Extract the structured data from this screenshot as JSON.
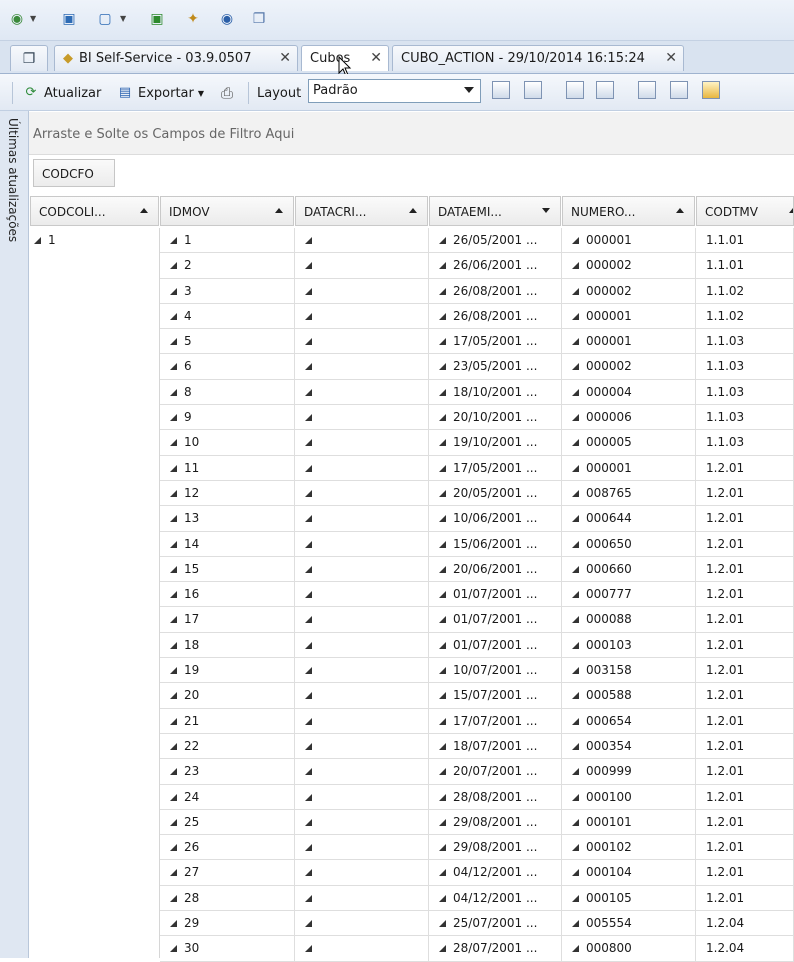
{
  "quick_access": {
    "icons": [
      "globe-add-icon",
      "window-restore-icon",
      "window-icon",
      "export-icon",
      "magic-wand-icon",
      "web-globe-icon",
      "copy-icon"
    ]
  },
  "tabs": [
    {
      "label": "BI Self-Service - 03.9.0507",
      "closable": true
    },
    {
      "label": "Cubos",
      "closable": true
    },
    {
      "label": "CUBO_ACTION - 29/10/2014 16:15:24",
      "closable": true
    }
  ],
  "toolbar": {
    "refresh_label": "Atualizar",
    "export_label": "Exportar",
    "layout_label": "Layout",
    "layout_value": "Padrão"
  },
  "side_panel": {
    "label": "Últimas atualizações"
  },
  "filter_area": {
    "placeholder": "Arraste e Solte os Campos de Filtro Aqui"
  },
  "row_field": {
    "label": "CODCFO"
  },
  "columns": [
    {
      "label": "CODCOLI...",
      "sort": "asc"
    },
    {
      "label": "IDMOV",
      "sort": "asc"
    },
    {
      "label": "DATACRI...",
      "sort": "asc"
    },
    {
      "label": "DATAEMI...",
      "sort": "desc"
    },
    {
      "label": "NUMERO...",
      "sort": "asc"
    },
    {
      "label": "CODTMV",
      "sort": "asc"
    }
  ],
  "group_value": "1",
  "rows": [
    {
      "idmov": "1",
      "dataemi": "26/05/2001 ...",
      "numero": "000001",
      "codtmv": "1.1.01"
    },
    {
      "idmov": "2",
      "dataemi": "26/06/2001 ...",
      "numero": "000002",
      "codtmv": "1.1.01"
    },
    {
      "idmov": "3",
      "dataemi": "26/08/2001 ...",
      "numero": "000002",
      "codtmv": "1.1.02"
    },
    {
      "idmov": "4",
      "dataemi": "26/08/2001 ...",
      "numero": "000001",
      "codtmv": "1.1.02"
    },
    {
      "idmov": "5",
      "dataemi": "17/05/2001 ...",
      "numero": "000001",
      "codtmv": "1.1.03"
    },
    {
      "idmov": "6",
      "dataemi": "23/05/2001 ...",
      "numero": "000002",
      "codtmv": "1.1.03"
    },
    {
      "idmov": "8",
      "dataemi": "18/10/2001 ...",
      "numero": "000004",
      "codtmv": "1.1.03"
    },
    {
      "idmov": "9",
      "dataemi": "20/10/2001 ...",
      "numero": "000006",
      "codtmv": "1.1.03"
    },
    {
      "idmov": "10",
      "dataemi": "19/10/2001 ...",
      "numero": "000005",
      "codtmv": "1.1.03"
    },
    {
      "idmov": "11",
      "dataemi": "17/05/2001 ...",
      "numero": "000001",
      "codtmv": "1.2.01"
    },
    {
      "idmov": "12",
      "dataemi": "20/05/2001 ...",
      "numero": "008765",
      "codtmv": "1.2.01"
    },
    {
      "idmov": "13",
      "dataemi": "10/06/2001 ...",
      "numero": "000644",
      "codtmv": "1.2.01"
    },
    {
      "idmov": "14",
      "dataemi": "15/06/2001 ...",
      "numero": "000650",
      "codtmv": "1.2.01"
    },
    {
      "idmov": "15",
      "dataemi": "20/06/2001 ...",
      "numero": "000660",
      "codtmv": "1.2.01"
    },
    {
      "idmov": "16",
      "dataemi": "01/07/2001 ...",
      "numero": "000777",
      "codtmv": "1.2.01"
    },
    {
      "idmov": "17",
      "dataemi": "01/07/2001 ...",
      "numero": "000088",
      "codtmv": "1.2.01"
    },
    {
      "idmov": "18",
      "dataemi": "01/07/2001 ...",
      "numero": "000103",
      "codtmv": "1.2.01"
    },
    {
      "idmov": "19",
      "dataemi": "10/07/2001 ...",
      "numero": "003158",
      "codtmv": "1.2.01"
    },
    {
      "idmov": "20",
      "dataemi": "15/07/2001 ...",
      "numero": "000588",
      "codtmv": "1.2.01"
    },
    {
      "idmov": "21",
      "dataemi": "17/07/2001 ...",
      "numero": "000654",
      "codtmv": "1.2.01"
    },
    {
      "idmov": "22",
      "dataemi": "18/07/2001 ...",
      "numero": "000354",
      "codtmv": "1.2.01"
    },
    {
      "idmov": "23",
      "dataemi": "20/07/2001 ...",
      "numero": "000999",
      "codtmv": "1.2.01"
    },
    {
      "idmov": "24",
      "dataemi": "28/08/2001 ...",
      "numero": "000100",
      "codtmv": "1.2.01"
    },
    {
      "idmov": "25",
      "dataemi": "29/08/2001 ...",
      "numero": "000101",
      "codtmv": "1.2.01"
    },
    {
      "idmov": "26",
      "dataemi": "29/08/2001 ...",
      "numero": "000102",
      "codtmv": "1.2.01"
    },
    {
      "idmov": "27",
      "dataemi": "04/12/2001 ...",
      "numero": "000104",
      "codtmv": "1.2.01"
    },
    {
      "idmov": "28",
      "dataemi": "04/12/2001 ...",
      "numero": "000105",
      "codtmv": "1.2.01"
    },
    {
      "idmov": "29",
      "dataemi": "25/07/2001 ...",
      "numero": "005554",
      "codtmv": "1.2.04"
    },
    {
      "idmov": "30",
      "dataemi": "28/07/2001 ...",
      "numero": "000800",
      "codtmv": "1.2.04"
    }
  ]
}
